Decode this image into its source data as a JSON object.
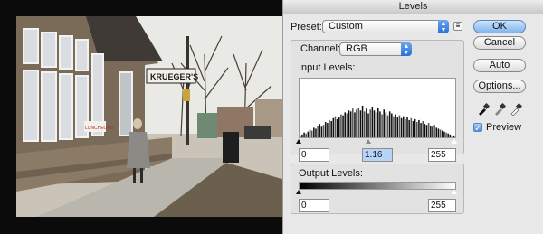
{
  "dialog": {
    "title": "Levels",
    "preset_label": "Preset:",
    "preset_value": "Custom",
    "channel_label": "Channel:",
    "channel_value": "RGB",
    "input_levels_label": "Input Levels:",
    "input_black": "0",
    "input_gamma": "1.16",
    "input_white": "255",
    "output_levels_label": "Output Levels:",
    "output_black": "0",
    "output_white": "255",
    "preview_label": "Preview",
    "preview_checked": true
  },
  "buttons": {
    "ok": "OK",
    "cancel": "Cancel",
    "auto": "Auto",
    "options": "Options..."
  },
  "photo": {
    "sign_text": "KRUEGER'S",
    "window_text": "LUNCHEONS"
  },
  "histogram": {
    "values": [
      2,
      3,
      5,
      4,
      6,
      8,
      7,
      10,
      9,
      12,
      14,
      11,
      13,
      16,
      15,
      18,
      17,
      20,
      22,
      19,
      21,
      24,
      23,
      26,
      25,
      28,
      27,
      30,
      26,
      29,
      31,
      28,
      33,
      27,
      30,
      25,
      29,
      32,
      28,
      26,
      31,
      27,
      24,
      29,
      26,
      23,
      27,
      25,
      22,
      24,
      21,
      23,
      20,
      22,
      19,
      21,
      18,
      20,
      17,
      19,
      16,
      18,
      15,
      17,
      14,
      13,
      15,
      12,
      11,
      13,
      10,
      9,
      8,
      7,
      6,
      5,
      4,
      3,
      2,
      2
    ]
  },
  "colors": {
    "ok_button": "#7fb4ee",
    "selected_field": "#b7d3f7"
  }
}
